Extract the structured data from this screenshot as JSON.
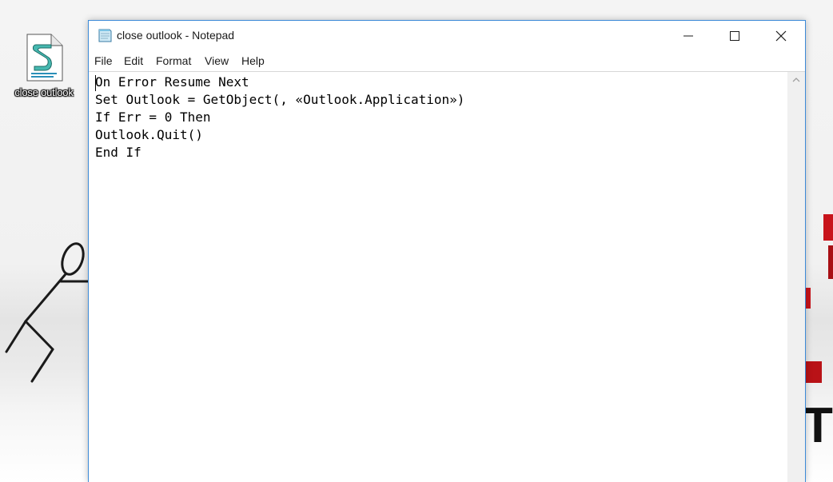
{
  "desktop": {
    "icon_label": "close outlook",
    "icon_name": "vbscript-file-icon",
    "backdrop_glyph": "T",
    "accent_red": "#c8141b"
  },
  "window": {
    "title": "close outlook - Notepad",
    "app_icon": "notepad-icon",
    "border_color": "#3c8ad8",
    "controls": {
      "minimize": "minimize-icon",
      "maximize": "maximize-icon",
      "close": "close-icon"
    }
  },
  "menu": {
    "file": "File",
    "edit": "Edit",
    "format": "Format",
    "view": "View",
    "help": "Help"
  },
  "editor": {
    "lines": [
      "On Error Resume Next",
      "Set Outlook = GetObject(, «Outlook.Application»)",
      "If Err = 0 Then",
      "Outlook.Quit()",
      "End If"
    ]
  },
  "scrollbar": {
    "up_icon": "chevron-up-icon"
  }
}
